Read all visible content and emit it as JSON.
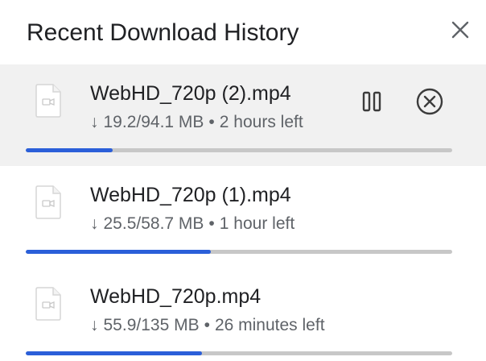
{
  "header": {
    "title": "Recent Download History",
    "close_icon": "close-icon"
  },
  "downloads": [
    {
      "filename": "WebHD_720p (2).mp4",
      "progress_text": "19.2/94.1 MB",
      "separator": "•",
      "time_left": "2 hours left",
      "progress_fraction": 0.204,
      "active": true,
      "icon": "file-icon",
      "actions": [
        "pause-icon",
        "cancel-icon"
      ]
    },
    {
      "filename": "WebHD_720p (1).mp4",
      "progress_text": "25.5/58.7 MB",
      "separator": "•",
      "time_left": "1 hour left",
      "progress_fraction": 0.434,
      "active": false,
      "icon": "file-icon"
    },
    {
      "filename": "WebHD_720p.mp4",
      "progress_text": "55.9/135 MB",
      "separator": "•",
      "time_left": "26 minutes left",
      "progress_fraction": 0.414,
      "active": false,
      "icon": "file-icon"
    }
  ],
  "colors": {
    "progress_fill": "#2b5fd9",
    "progress_track": "#c7c7c7",
    "active_row": "#f1f1f1"
  }
}
